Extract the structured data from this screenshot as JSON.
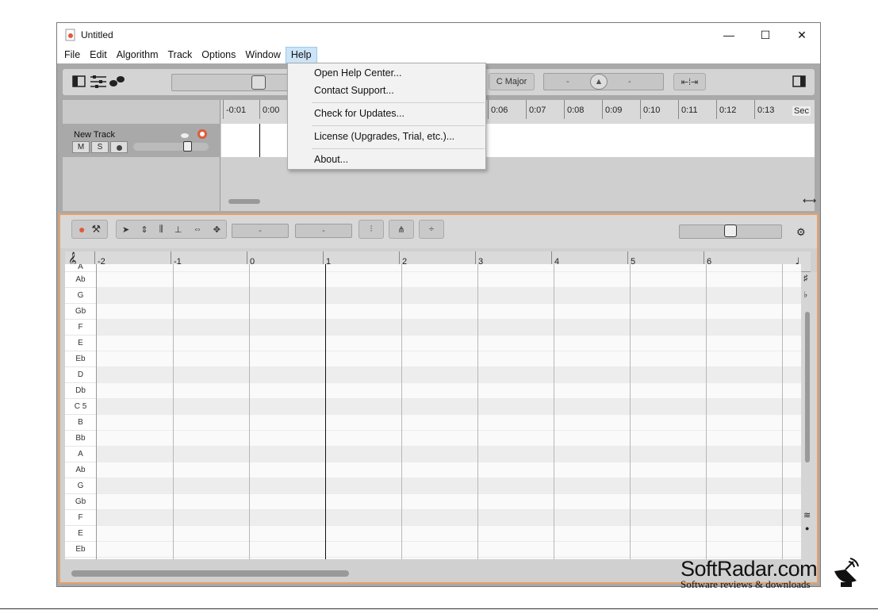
{
  "window": {
    "title": "Untitled",
    "minimize": "—",
    "maximize": "☐",
    "close": "✕"
  },
  "menubar": [
    "File",
    "Edit",
    "Algorithm",
    "Track",
    "Options",
    "Window",
    "Help"
  ],
  "help_menu": {
    "items": [
      "Open Help Center...",
      "Contact Support...",
      "Check for Updates...",
      "License (Upgrades, Trial, etc.)...",
      "About..."
    ]
  },
  "toolbar": {
    "key": "C Major",
    "pitch_left": "-",
    "pitch_right": "-"
  },
  "timeline": {
    "ticks": [
      "-0:01",
      "0:00",
      "0:06",
      "0:07",
      "0:08",
      "0:09",
      "0:10",
      "0:11",
      "0:12",
      "0:13"
    ],
    "unit": "Sec"
  },
  "track": {
    "name": "New Track",
    "mute": "M",
    "solo": "S"
  },
  "editor": {
    "field1": "-",
    "field2": "-",
    "bar_ruler": [
      "-2",
      "-1",
      "0",
      "1",
      "2",
      "3",
      "4",
      "5",
      "6"
    ],
    "keys": [
      "A",
      "Ab",
      "G",
      "Gb",
      "F",
      "E",
      "Eb",
      "D",
      "Db",
      "C 5",
      "B",
      "Bb",
      "A",
      "Ab",
      "G",
      "Gb",
      "F",
      "E",
      "Eb"
    ]
  },
  "watermark": {
    "main": "SoftRadar.com",
    "sub": "Software reviews & downloads"
  }
}
